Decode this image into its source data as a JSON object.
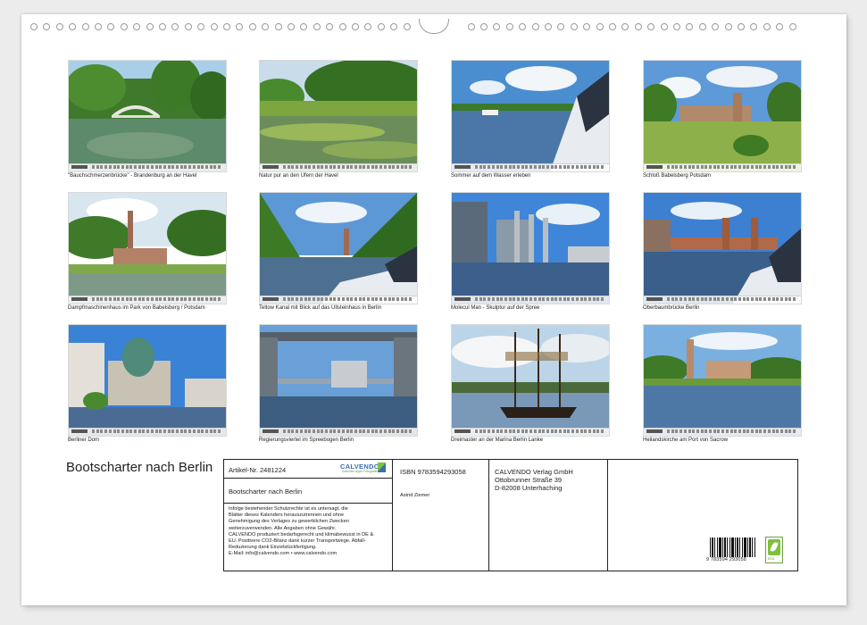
{
  "photos": [
    {
      "caption": "\"Bauchschmerzenbrücke\" - Brandenburg an der Havel"
    },
    {
      "caption": "Natur pur an den Ufern der Havel"
    },
    {
      "caption": "Sommer auf dem Wasser erleben"
    },
    {
      "caption": "Schloß Babelsberg Potsdam"
    },
    {
      "caption": "Dampfmaschinenhaus im Park von Babelsberg / Potsdam"
    },
    {
      "caption": "Teltow Kanal mit Blick auf das Ullsteinhaus in Berlin"
    },
    {
      "caption": "Molecul Man - Skulptur auf der Spree"
    },
    {
      "caption": "Oberbaumbrücke Berlin"
    },
    {
      "caption": "Berliner Dom"
    },
    {
      "caption": "Regierungsviertel im Spreebogen Berlin"
    },
    {
      "caption": "Dreimaster an der Marina Berlin Lanke"
    },
    {
      "caption": "Heilandskirche am Port von Sacrow"
    }
  ],
  "title": "Bootscharter nach Berlin",
  "info": {
    "article_no": "Artikel-Nr. 2481224",
    "logo_word": "CALVENDO",
    "logo_sub": "Kalender Apps Fotografie",
    "calendar_title": "Bootscharter nach Berlin",
    "legal_lines": [
      "Infolge bestehender Schutzrechte ist es untersagt, die",
      "Blätter dieses Kalenders herauszutrennen und ohne",
      "Genehmigung des Verlages zu gewerblichen Zwecken",
      "weiterzuverwenden. Alle Angaben ohne Gewähr.",
      "CALVENDO produziert bedarfsgerecht und klimabewusst in DE &",
      "EU. Positivere CO2-Bilanz dank kurzer Transportwege. Abfall-",
      "Reduzierung dank Einzelstückfertigung.",
      "E-Mail: info@calvendo.com • www.calvendo.com"
    ],
    "isbn": "ISBN 9783594293058",
    "author": "Astrid Ziemer",
    "publisher_lines": [
      "CALVENDO Verlag GmbH",
      "Ottobrunner Straße 39",
      "D-82008 Unterhaching"
    ],
    "barcode_number": "9 783594 293058",
    "eco_label": "eco"
  },
  "colors": {
    "border": "#222222",
    "calvendo_blue": "#3a6fb0",
    "eco_green": "#7fbf3f"
  }
}
